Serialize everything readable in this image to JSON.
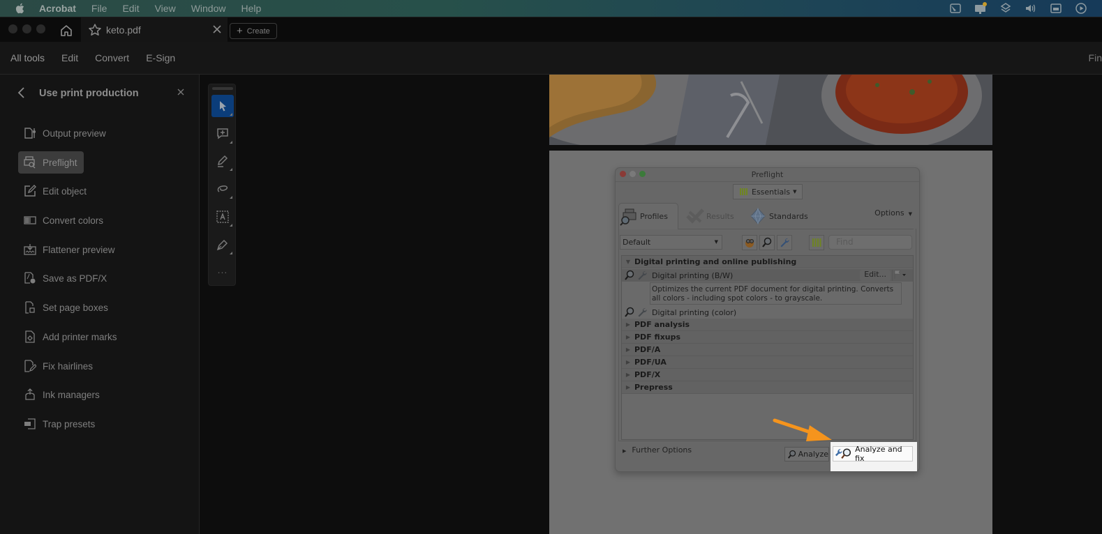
{
  "menubar": {
    "app_name": "Acrobat",
    "items": [
      "File",
      "Edit",
      "View",
      "Window",
      "Help"
    ],
    "tray_icons": [
      "screen-mirror-icon",
      "notification-display-icon",
      "layers-icon",
      "volume-icon",
      "calendar-icon",
      "play-circle-icon"
    ]
  },
  "window": {
    "tab": {
      "filename": "keto.pdf"
    },
    "create_label": "Create"
  },
  "toolbar": {
    "items": [
      "All tools",
      "Edit",
      "Convert",
      "E-Sign"
    ],
    "find_label": "Fin"
  },
  "left_panel": {
    "title": "Use print production",
    "items": [
      {
        "label": "Output preview",
        "icon": "output-preview-icon",
        "active": false
      },
      {
        "label": "Preflight",
        "icon": "preflight-icon",
        "active": true
      },
      {
        "label": "Edit object",
        "icon": "edit-object-icon",
        "active": false
      },
      {
        "label": "Convert colors",
        "icon": "convert-colors-icon",
        "active": false
      },
      {
        "label": "Flattener preview",
        "icon": "flattener-preview-icon",
        "active": false
      },
      {
        "label": "Save as PDF/X",
        "icon": "save-pdfx-icon",
        "active": false
      },
      {
        "label": "Set page boxes",
        "icon": "page-boxes-icon",
        "active": false
      },
      {
        "label": "Add printer marks",
        "icon": "printer-marks-icon",
        "active": false
      },
      {
        "label": "Fix hairlines",
        "icon": "fix-hairlines-icon",
        "active": false
      },
      {
        "label": "Ink managers",
        "icon": "ink-manager-icon",
        "active": false
      },
      {
        "label": "Trap presets",
        "icon": "trap-presets-icon",
        "active": false
      }
    ]
  },
  "quick_tools": {
    "tools": [
      "select",
      "add-comment",
      "draw",
      "lasso",
      "text-recognition",
      "fill-sign"
    ],
    "more_label": "..."
  },
  "preflight": {
    "title": "Preflight",
    "library_button": "Essentials",
    "tabs": [
      {
        "label": "Profiles",
        "state": "active"
      },
      {
        "label": "Results",
        "state": "disabled"
      },
      {
        "label": "Standards",
        "state": "normal"
      }
    ],
    "options_label": "Options",
    "profile_select": "Default",
    "find_placeholder": "Find",
    "groups": [
      {
        "label": "Digital printing and online publishing",
        "expanded": true,
        "profiles": [
          {
            "label": "Digital printing (B/W)",
            "selected": true,
            "edit_label": "Edit...",
            "description": "Optimizes the current PDF document for digital printing. Converts all colors - including spot colors - to grayscale."
          },
          {
            "label": "Digital printing (color)",
            "selected": false
          }
        ]
      },
      {
        "label": "PDF analysis",
        "expanded": false
      },
      {
        "label": "PDF fixups",
        "expanded": false
      },
      {
        "label": "PDF/A",
        "expanded": false
      },
      {
        "label": "PDF/UA",
        "expanded": false
      },
      {
        "label": "PDF/X",
        "expanded": false
      },
      {
        "label": "Prepress",
        "expanded": false
      }
    ],
    "further_options": "Further Options",
    "analyze_label": "Analyze",
    "analyze_fix_label": "Analyze and fix"
  },
  "colors": {
    "accent_selected_tool": "#0b3d7a",
    "annotation_arrow": "#f5941d",
    "essentials_bars": "#a7c72a"
  }
}
